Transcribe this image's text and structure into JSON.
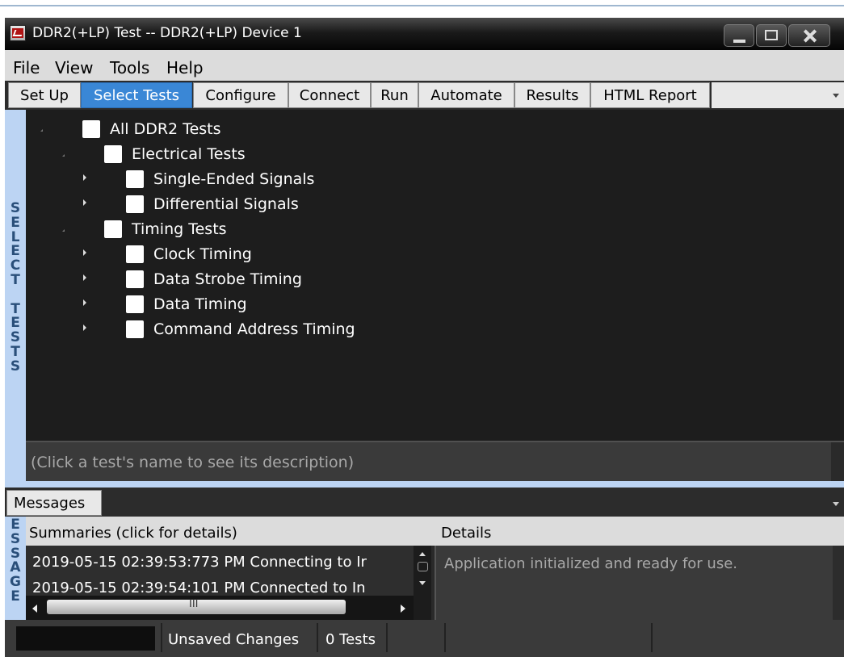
{
  "window": {
    "title": "DDR2(+LP) Test -- DDR2(+LP) Device 1"
  },
  "menu": {
    "items": [
      "File",
      "View",
      "Tools",
      "Help"
    ]
  },
  "tabs": [
    {
      "label": "Set Up",
      "active": false
    },
    {
      "label": "Select Tests",
      "active": true
    },
    {
      "label": "Configure",
      "active": false
    },
    {
      "label": "Connect",
      "active": false
    },
    {
      "label": "Run",
      "active": false
    },
    {
      "label": "Automate",
      "active": false
    },
    {
      "label": "Results",
      "active": false
    },
    {
      "label": "HTML Report",
      "active": false
    }
  ],
  "side_label": "SELECT TESTS",
  "tree": [
    {
      "label": "All DDR2 Tests",
      "expanded": true,
      "checked": false
    },
    {
      "label": "Electrical Tests",
      "expanded": true,
      "checked": false
    },
    {
      "label": "Single-Ended Signals",
      "expanded": false,
      "checked": false
    },
    {
      "label": "Differential Signals",
      "expanded": false,
      "checked": false
    },
    {
      "label": "Timing Tests",
      "expanded": true,
      "checked": false
    },
    {
      "label": "Clock Timing",
      "expanded": false,
      "checked": false
    },
    {
      "label": "Data Strobe Timing",
      "expanded": false,
      "checked": false
    },
    {
      "label": "Data Timing",
      "expanded": false,
      "checked": false
    },
    {
      "label": "Command Address Timing",
      "expanded": false,
      "checked": false
    }
  ],
  "description_placeholder": "(Click a test's name to see its description)",
  "messages": {
    "tab": "Messages",
    "side_label": "ESSAGE",
    "summaries_header": "Summaries (click for details)",
    "details_header": "Details",
    "summaries": [
      "2019-05-15 02:39:53:773 PM Connecting to Ir",
      "2019-05-15 02:39:54:101 PM Connected to In"
    ],
    "details": "Application initialized and ready for use.",
    "scroll_grip": "III"
  },
  "status": {
    "unsaved": "Unsaved Changes",
    "tests": "0 Tests"
  },
  "colors": {
    "accent": "#3a87d6",
    "side_strip": "#bcd4f3",
    "panel_bg": "#1d1d1d"
  }
}
